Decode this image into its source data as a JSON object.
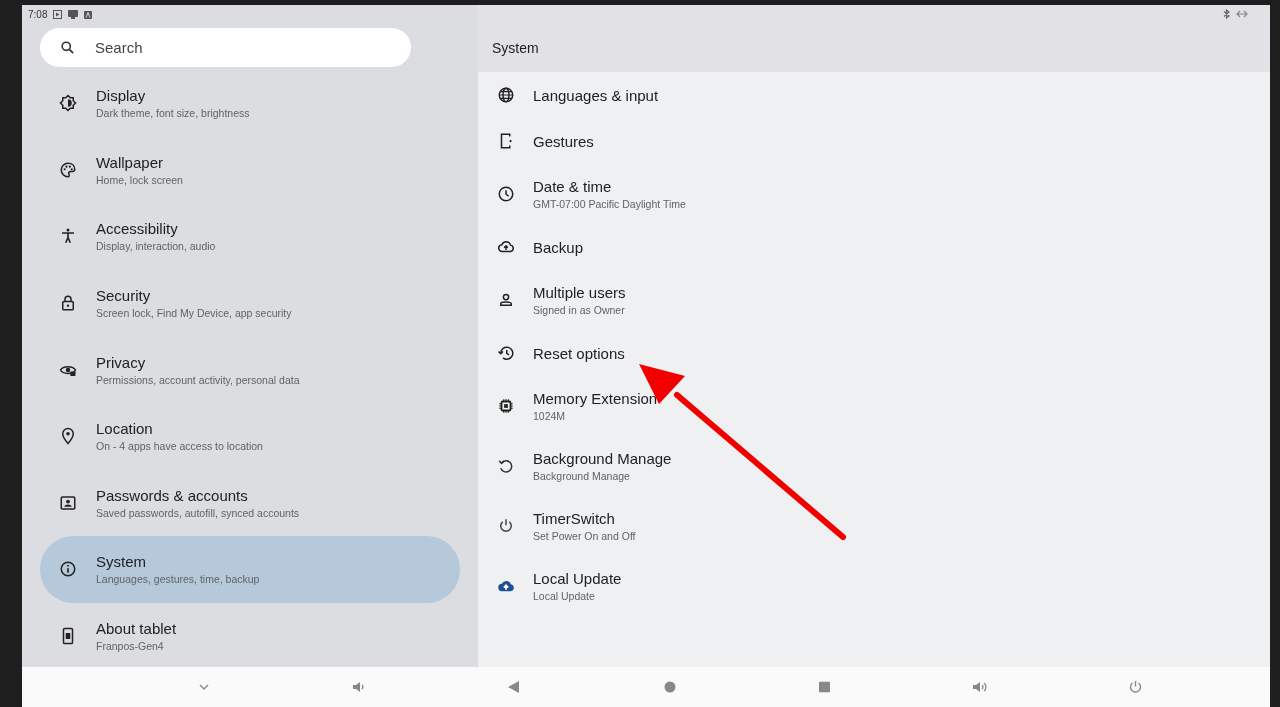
{
  "status_bar": {
    "time": "7:08"
  },
  "search": {
    "placeholder": "Search"
  },
  "sidebar": {
    "items": [
      {
        "title": "Display",
        "subtitle": "Dark theme, font size, brightness",
        "selected": false
      },
      {
        "title": "Wallpaper",
        "subtitle": "Home, lock screen",
        "selected": false
      },
      {
        "title": "Accessibility",
        "subtitle": "Display, interaction, audio",
        "selected": false
      },
      {
        "title": "Security",
        "subtitle": "Screen lock, Find My Device, app security",
        "selected": false
      },
      {
        "title": "Privacy",
        "subtitle": "Permissions, account activity, personal data",
        "selected": false
      },
      {
        "title": "Location",
        "subtitle": "On - 4 apps have access to location",
        "selected": false
      },
      {
        "title": "Passwords & accounts",
        "subtitle": "Saved passwords, autofill, synced accounts",
        "selected": false
      },
      {
        "title": "System",
        "subtitle": "Languages, gestures, time, backup",
        "selected": true
      },
      {
        "title": "About tablet",
        "subtitle": "Franpos-Gen4",
        "selected": false
      }
    ]
  },
  "detail": {
    "title": "System",
    "items": [
      {
        "title": "Languages & input"
      },
      {
        "title": "Gestures"
      },
      {
        "title": "Date & time",
        "subtitle": "GMT-07:00 Pacific Daylight Time"
      },
      {
        "title": "Backup"
      },
      {
        "title": "Multiple users",
        "subtitle": "Signed in as Owner"
      },
      {
        "title": "Reset options"
      },
      {
        "title": "Memory Extension",
        "subtitle": "1024M"
      },
      {
        "title": "Background Manage",
        "subtitle": "Background Manage"
      },
      {
        "title": "TimerSwitch",
        "subtitle": "Set Power On and Off"
      },
      {
        "title": "Local Update",
        "subtitle": "Local Update"
      }
    ]
  }
}
